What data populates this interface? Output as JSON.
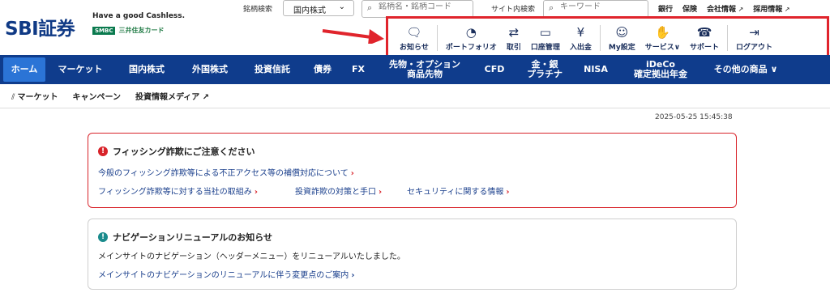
{
  "header": {
    "logo": "SBI証券",
    "tagline": "Have a good Cashless.",
    "smbc_badge": "SMBC",
    "smbc_text": "三井住友カード",
    "stock_search_label": "銘柄検索",
    "market_select_value": "国内株式",
    "stock_search_placeholder": "銘柄名・銘柄コード",
    "site_search_label": "サイト内検索",
    "site_search_placeholder": "キーワード",
    "top_links": [
      "銀行",
      "保険",
      "会社情報",
      "採用情報"
    ]
  },
  "icon_nav": [
    {
      "icon": "message-icon",
      "glyph": "🗨",
      "label": "お知らせ"
    },
    {
      "icon": "pie-chart-icon",
      "glyph": "◔",
      "label": "ポートフォリオ"
    },
    {
      "icon": "exchange-icon",
      "glyph": "⇄",
      "label": "取引"
    },
    {
      "icon": "card-icon",
      "glyph": "▭",
      "label": "口座管理"
    },
    {
      "icon": "yen-coin-icon",
      "glyph": "¥",
      "label": "入出金"
    },
    {
      "icon": "user-gear-icon",
      "glyph": "☺",
      "label": "My設定"
    },
    {
      "icon": "hand-coins-icon",
      "glyph": "✋",
      "label": "サービス∨"
    },
    {
      "icon": "headset-icon",
      "glyph": "☎",
      "label": "サポート"
    },
    {
      "icon": "logout-icon",
      "glyph": "⇥",
      "label": "ログアウト"
    }
  ],
  "main_nav": [
    {
      "line1": "ホーム",
      "line2": ""
    },
    {
      "line1": "マーケット",
      "line2": ""
    },
    {
      "line1": "国内株式",
      "line2": ""
    },
    {
      "line1": "外国株式",
      "line2": ""
    },
    {
      "line1": "投資信託",
      "line2": ""
    },
    {
      "line1": "債券",
      "line2": ""
    },
    {
      "line1": "FX",
      "line2": ""
    },
    {
      "line1": "先物・オプション",
      "line2": "商品先物"
    },
    {
      "line1": "CFD",
      "line2": ""
    },
    {
      "line1": "金・銀",
      "line2": "プラチナ"
    },
    {
      "line1": "NISA",
      "line2": ""
    },
    {
      "line1": "iDeCo",
      "line2": "確定拠出年金"
    },
    {
      "line1": "その他の商品 ∨",
      "line2": ""
    }
  ],
  "sub_nav": {
    "market": "マーケット",
    "campaign": "キャンペーン",
    "media": "投資情報メディア ↗"
  },
  "timestamp": "2025-05-25 15:45:38",
  "phishing_notice": {
    "title": "フィッシング詐欺にご注意ください",
    "link1": "今般のフィッシング詐欺等による不正アクセス等の補償対応について",
    "link2": "フィッシング詐欺等に対する当社の取組み",
    "link3": "投資詐欺の対策と手口",
    "link4": "セキュリティに関する情報"
  },
  "nav_notice": {
    "title": "ナビゲーションリニューアルのお知らせ",
    "body": "メインサイトのナビゲーション（ヘッダーメニュー）をリニューアルいたしました。",
    "link": "メインサイトのナビゲーションのリニューアルに伴う変更点のご案内"
  },
  "colors": {
    "brand_navy": "#0f3c8c",
    "active_tab": "#2b74d6",
    "alert_red": "#d8232a",
    "info_teal": "#1a8b8c"
  }
}
